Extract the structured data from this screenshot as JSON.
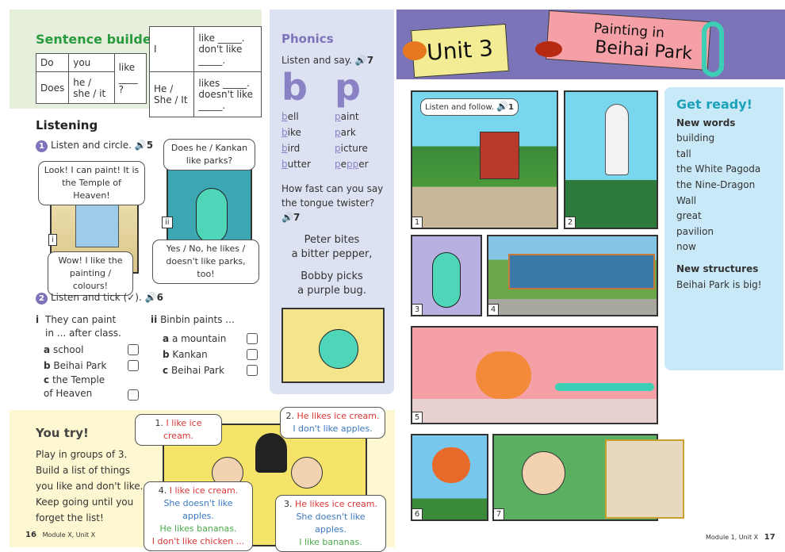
{
  "sentence_builder": {
    "title": "Sentence builder",
    "question_table": {
      "rows": [
        [
          "Do",
          "you"
        ],
        [
          "Does",
          "he / she / it"
        ]
      ],
      "verb": "like",
      "blank": "____ ?"
    },
    "answer_table": {
      "rows": [
        {
          "subject": "I",
          "pos": "like _____.",
          "neg": "don't like _____."
        },
        {
          "subject": "He / She / It",
          "pos": "likes _____.",
          "neg": "doesn't like _____."
        }
      ]
    }
  },
  "listening": {
    "title": "Listening",
    "ex1": {
      "num": "1",
      "instruction": "Listen and circle.",
      "track": "5",
      "pic_i": {
        "label": "i",
        "bubble_top": "Look! I can paint! It is the Temple of Heaven!",
        "bubble_bottom": "Wow! I like the painting / colours!"
      },
      "pic_ii": {
        "label": "ii",
        "bubble_top": "Does he / Kankan like parks?",
        "bubble_bottom": "Yes / No, he likes / doesn't like parks, too!"
      }
    },
    "ex2": {
      "num": "2",
      "instruction": "Listen and tick (✓).",
      "track": "6",
      "q1": {
        "num": "i",
        "text": "They can paint in ... after class.",
        "options": [
          {
            "l": "a",
            "t": "school"
          },
          {
            "l": "b",
            "t": "Beihai Park"
          },
          {
            "l": "c",
            "t": "the Temple of Heaven"
          }
        ]
      },
      "q2": {
        "num": "ii",
        "text": "Binbin paints ...",
        "options": [
          {
            "l": "a",
            "t": "a mountain"
          },
          {
            "l": "b",
            "t": "Kankan"
          },
          {
            "l": "c",
            "t": "Beihai Park"
          }
        ]
      }
    }
  },
  "phonics": {
    "title": "Phonics",
    "instruction": "Listen and say.",
    "track": "7",
    "letters": [
      "b",
      "p"
    ],
    "b_words": [
      [
        "b",
        "ell"
      ],
      [
        "b",
        "ike"
      ],
      [
        "b",
        "ird"
      ],
      [
        "b",
        "utter"
      ]
    ],
    "p_words": [
      [
        "p",
        "aint"
      ],
      [
        "p",
        "ark"
      ],
      [
        "p",
        "icture"
      ],
      [
        "p",
        "e",
        "pp",
        "er"
      ]
    ],
    "twister_q": "How fast can you say the tongue twister?",
    "twister_track": "7",
    "twister": [
      "Peter bites",
      "a bitter pepper,",
      "Bobby picks",
      "a purple bug."
    ]
  },
  "you_try": {
    "title": "You try!",
    "lines": [
      "Play in groups of 3.",
      "Build a list of things",
      "you like and don't like.",
      "Keep going until you",
      "forget the list!"
    ],
    "b1": {
      "n": "1.",
      "l1": "I like ice cream."
    },
    "b2": {
      "n": "2.",
      "l1": "He likes ice cream.",
      "l2": "I don't like apples."
    },
    "b3": {
      "n": "3.",
      "l1": "He likes ice cream.",
      "l2": "She doesn't like apples.",
      "l3": "I like bananas."
    },
    "b4": {
      "n": "4.",
      "l1": "I like ice cream.",
      "l2": "She doesn't like apples.",
      "l3": "He likes bananas.",
      "l4": "I don't like chicken ..."
    }
  },
  "footer_left": {
    "page": "16",
    "text": "Module X, Unit X"
  },
  "footer_right": {
    "page": "17",
    "text": "Module 1, Unit X"
  },
  "unit": {
    "label": "Unit 3",
    "title_l1": "Painting in",
    "title_l2": "Beihai Park"
  },
  "comic": {
    "instruction": "Listen and follow.",
    "track": "1",
    "panels": [
      "1",
      "2",
      "3",
      "4",
      "5",
      "6",
      "7"
    ]
  },
  "get_ready": {
    "title": "Get ready!",
    "new_words_title": "New words",
    "new_words": [
      "building",
      "tall",
      "the White Pagoda",
      "the Nine-Dragon Wall",
      "great",
      "pavilion",
      "now"
    ],
    "new_structures_title": "New structures",
    "new_structures": [
      "Beihai Park is big!"
    ]
  },
  "colors": {
    "header": "#7b74b8",
    "sentence_green": "#2a9a3e",
    "phonics_bg": "#dde2f2",
    "get_ready_bg": "#c9e9f8",
    "you_try_bg": "#fdf8d2"
  }
}
